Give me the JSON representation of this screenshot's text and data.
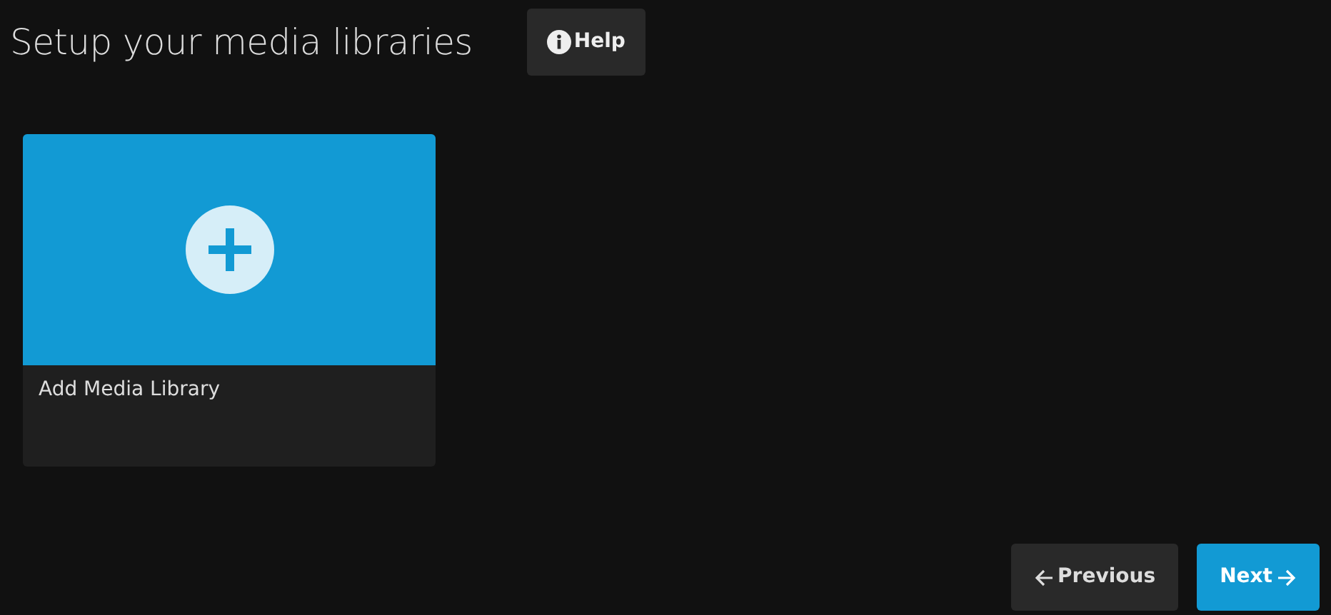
{
  "title": "Setup your media libraries",
  "help_button": {
    "label": "Help"
  },
  "libraries": [
    {
      "kind": "add",
      "label": "Add Media Library"
    }
  ],
  "navigation": [
    {
      "kind": "previous",
      "label": "Previous"
    },
    {
      "kind": "next",
      "label": "Next"
    }
  ]
}
